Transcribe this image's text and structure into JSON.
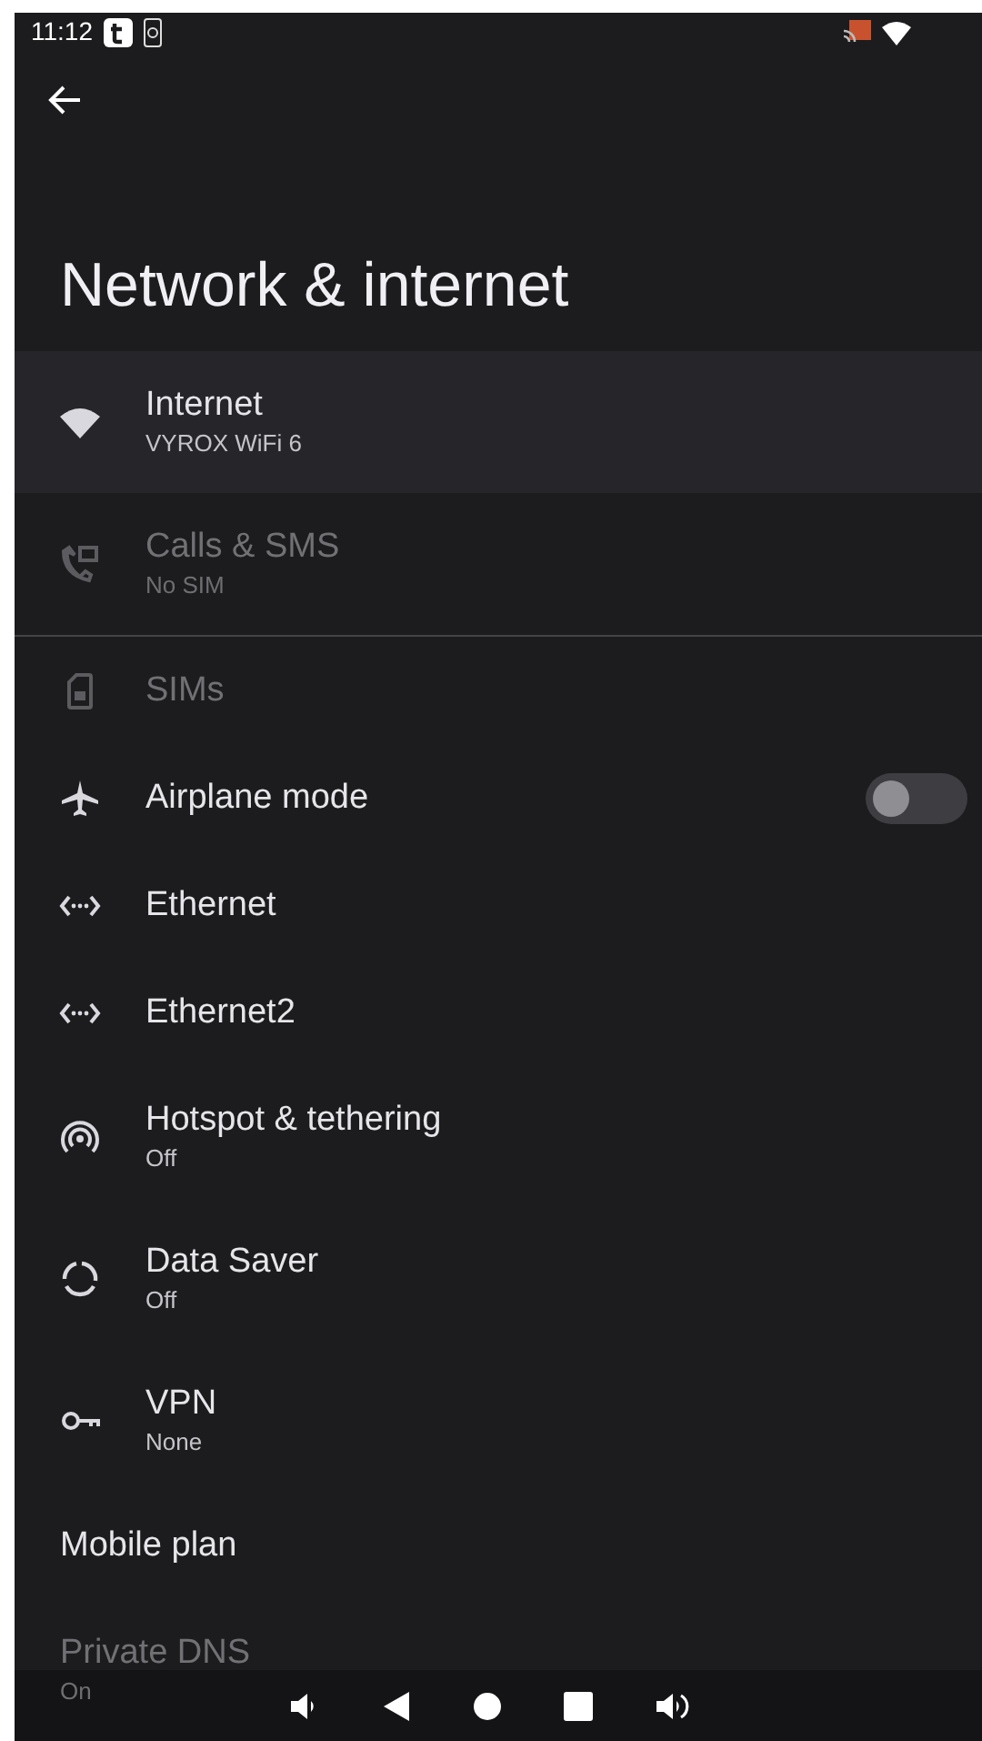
{
  "status_bar": {
    "time": "11:12"
  },
  "title": "Network & internet",
  "sections": [
    {
      "items": [
        {
          "kind": "link",
          "title": "Internet",
          "subtitle": "VYROX WiFi 6",
          "selected": true,
          "disabled": false
        },
        {
          "kind": "link",
          "title": "Calls & SMS",
          "subtitle": "No SIM",
          "selected": false,
          "disabled": true
        }
      ]
    },
    {
      "items": [
        {
          "kind": "link",
          "title": "SIMs",
          "selected": false,
          "disabled": true
        },
        {
          "kind": "toggle",
          "title": "Airplane mode",
          "on": false,
          "selected": false,
          "disabled": false
        },
        {
          "kind": "link",
          "title": "Ethernet",
          "selected": false,
          "disabled": false
        },
        {
          "kind": "link",
          "title": "Ethernet2",
          "selected": false,
          "disabled": false
        },
        {
          "kind": "link",
          "title": "Hotspot & tethering",
          "subtitle": "Off",
          "selected": false,
          "disabled": false
        },
        {
          "kind": "link",
          "title": "Data Saver",
          "subtitle": "Off",
          "selected": false,
          "disabled": false
        },
        {
          "kind": "link",
          "title": "VPN",
          "subtitle": "None",
          "selected": false,
          "disabled": false
        },
        {
          "kind": "plain",
          "title": "Mobile plan",
          "selected": false,
          "disabled": false
        },
        {
          "kind": "plain",
          "title": "Private DNS",
          "subtitle": "On",
          "selected": false,
          "disabled": true
        }
      ]
    }
  ]
}
